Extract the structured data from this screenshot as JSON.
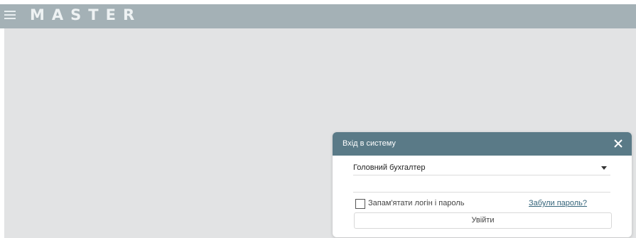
{
  "app": {
    "brand": "MASTER",
    "menu_icon": "hamburger-menu-icon"
  },
  "login_dialog": {
    "title": "Вхід в систему",
    "close_icon": "close-icon",
    "role_select": {
      "selected": "Головний бухгалтер",
      "icon": "chevron-down-icon"
    },
    "password": {
      "value": "",
      "placeholder": ""
    },
    "remember_label": "Запам'ятати логін і пароль",
    "remember_checked": false,
    "forgot_password_label": "Забули пароль?",
    "login_button_label": "Увійти"
  },
  "colors": {
    "header_bg": "#a4b1b6",
    "dialog_header_bg": "#5a7a87",
    "workspace_bg": "#e2e3e4",
    "link": "#34647a"
  }
}
